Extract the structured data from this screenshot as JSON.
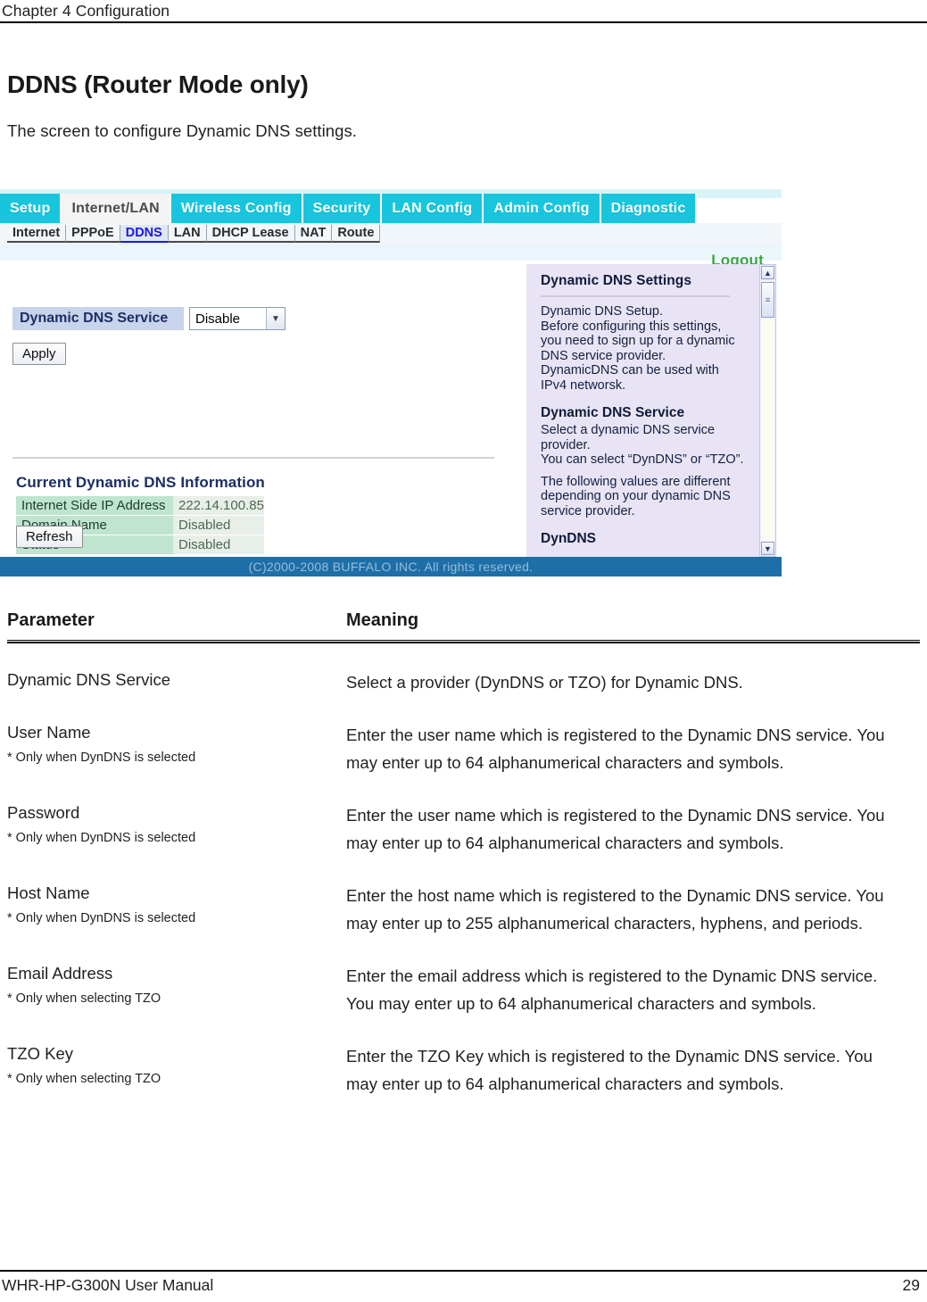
{
  "running_head": "Chapter 4  Configuration",
  "title": "DDNS (Router Mode only)",
  "subtitle": "The screen to configure Dynamic DNS settings.",
  "screenshot": {
    "tabs": [
      {
        "label": "Setup",
        "active": false
      },
      {
        "label": "Internet/LAN",
        "active": true
      },
      {
        "label": "Wireless Config",
        "active": false
      },
      {
        "label": "Security",
        "active": false
      },
      {
        "label": "LAN Config",
        "active": false
      },
      {
        "label": "Admin Config",
        "active": false
      },
      {
        "label": "Diagnostic",
        "active": false
      }
    ],
    "subtabs": [
      {
        "label": "Internet",
        "active": false
      },
      {
        "label": "PPPoE",
        "active": false
      },
      {
        "label": "DDNS",
        "active": true
      },
      {
        "label": "LAN",
        "active": false
      },
      {
        "label": "DHCP Lease",
        "active": false
      },
      {
        "label": "NAT",
        "active": false
      },
      {
        "label": "Route",
        "active": false
      }
    ],
    "logout_label": "Logout",
    "service_field_label": "Dynamic DNS Service",
    "service_field_value": "Disable",
    "apply_button": "Apply",
    "refresh_button": "Refresh",
    "info_section_title": "Current Dynamic DNS Information",
    "info_rows": [
      {
        "key": "Internet Side IP Address",
        "value": "222.14.100.85"
      },
      {
        "key": "Domain Name",
        "value": "Disabled"
      },
      {
        "key": "Status",
        "value": "Disabled"
      }
    ],
    "help": {
      "heading1": "Dynamic DNS Settings",
      "body1": "Dynamic DNS Setup.\nBefore configuring this settings, you need to sign up for a dynamic DNS service provider.\nDynamicDNS can be used with IPv4 networsk.",
      "heading2": "Dynamic DNS Service",
      "body2": "Select a dynamic DNS service provider.\nYou can select “DynDNS” or “TZO”.",
      "body3": "The following values are different depending on your dynamic DNS service provider.",
      "heading3": "DynDNS"
    },
    "scrollbar": {
      "up_arrow": "chevron-up-icon",
      "down_arrow": "chevron-down-icon"
    },
    "footer": "(C)2000-2008 BUFFALO INC. All rights reserved."
  },
  "table": {
    "header": {
      "parameter": "Parameter",
      "meaning": "Meaning"
    },
    "rows": [
      {
        "name": "Dynamic DNS Service",
        "note": "",
        "meaning": "Select a provider (DynDNS or TZO) for Dynamic DNS."
      },
      {
        "name": "User Name",
        "note": "* Only when DynDNS is selected",
        "meaning": "Enter the user name which is registered to the Dynamic DNS service. You may enter up to 64 alphanumerical characters and symbols."
      },
      {
        "name": "Password",
        "note": "* Only when DynDNS is selected",
        "meaning": "Enter the user name which is registered to the Dynamic DNS service. You may enter up to 64 alphanumerical characters and symbols."
      },
      {
        "name": "Host Name",
        "note": "* Only when DynDNS is selected",
        "meaning": "Enter the host name which is registered to the Dynamic DNS service. You may enter up to 255 alphanumerical characters, hyphens, and periods."
      },
      {
        "name": "Email Address",
        "note": "* Only when selecting TZO",
        "meaning": "Enter the email address which is registered to the Dynamic DNS service. You may enter up to 64 alphanumerical characters and symbols."
      },
      {
        "name": "TZO Key",
        "note": "* Only when selecting TZO",
        "meaning": "Enter the TZO Key which is registered to the Dynamic DNS service. You may enter up to 64 alphanumerical characters and symbols."
      }
    ]
  },
  "page_footer": {
    "manual": "WHR-HP-G300N User Manual",
    "page_number": "29"
  }
}
